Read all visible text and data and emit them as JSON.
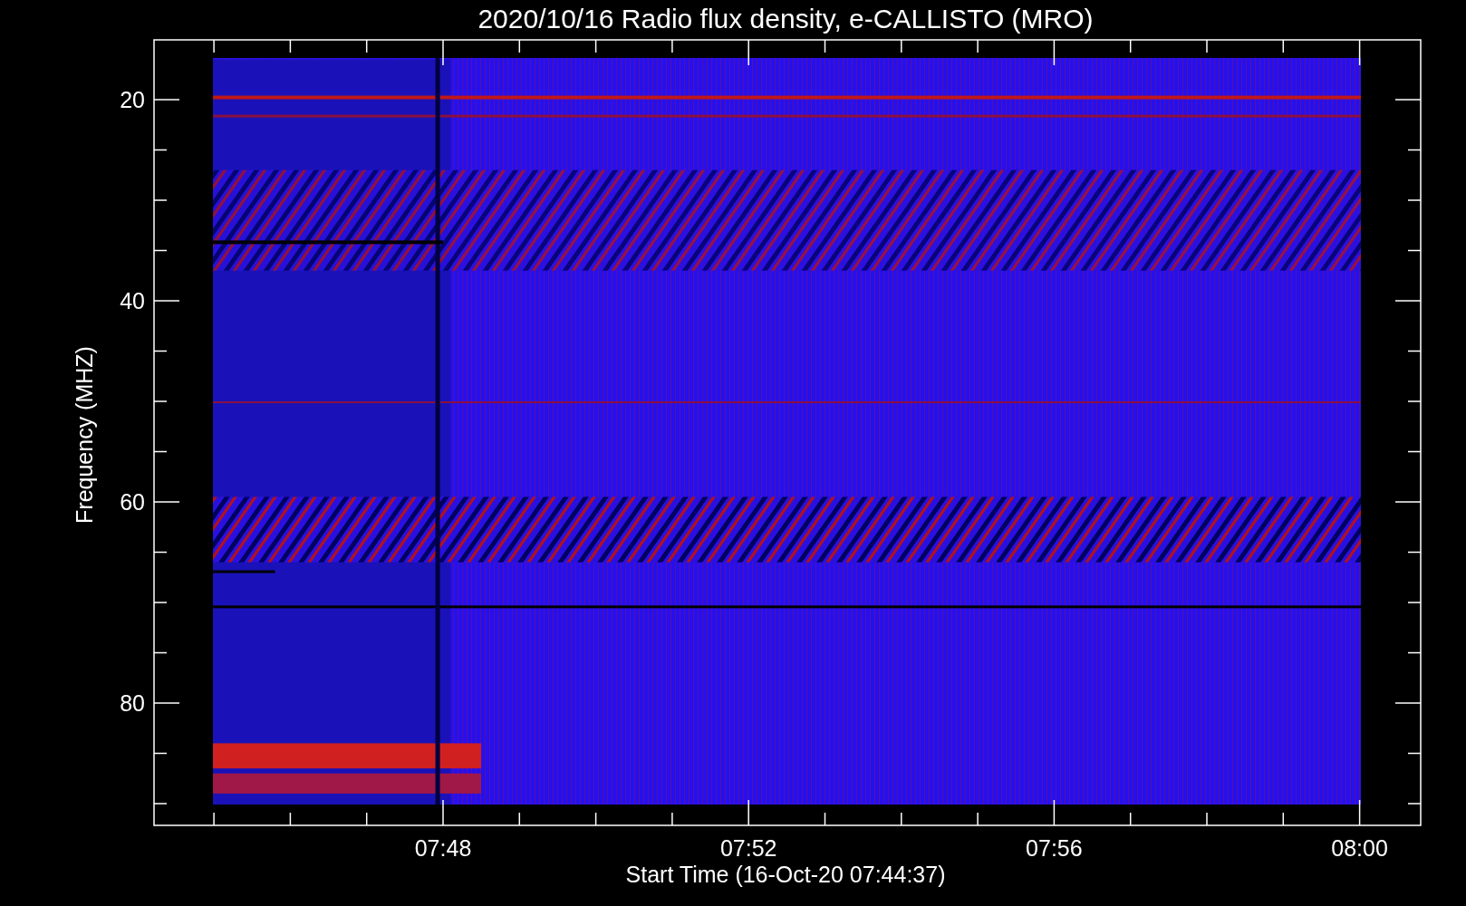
{
  "title": "2020/10/16  Radio flux density, e-CALLISTO (MRO)",
  "plot": {
    "xlabel": "Start Time (16-Oct-20 07:44:37)",
    "ylabel": "Frequency (MHZ)",
    "xticks": [
      "07:48",
      "07:52",
      "07:56",
      "08:00"
    ],
    "yticks": [
      "20",
      "40",
      "60",
      "80"
    ]
  }
}
